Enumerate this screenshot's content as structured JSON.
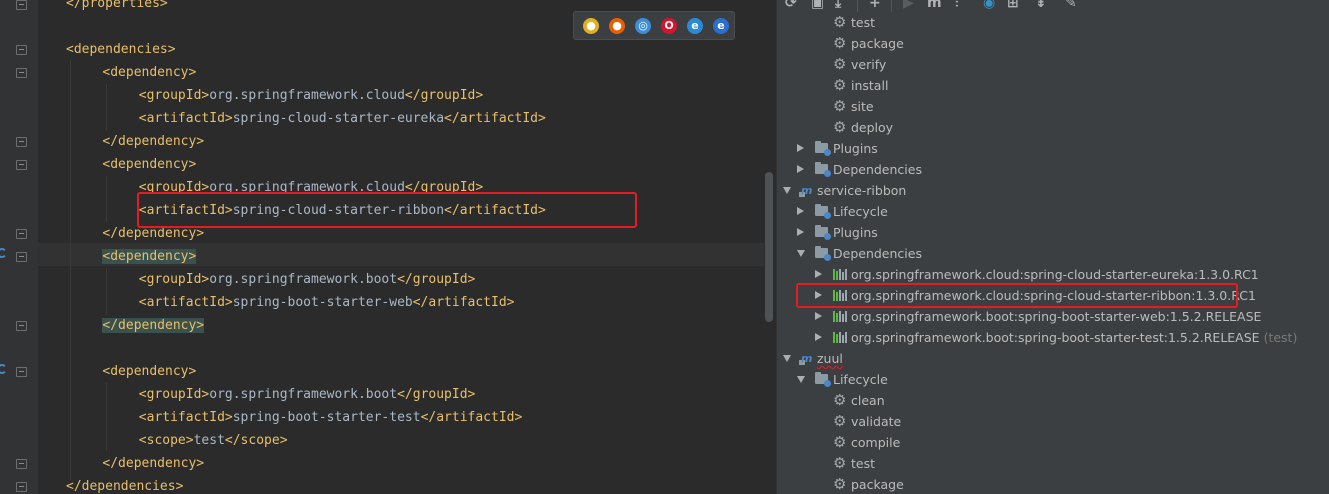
{
  "editor": {
    "lines": [
      {
        "indent": 0,
        "parts": [
          {
            "t": "tag",
            "v": "</properties>"
          }
        ]
      },
      {
        "indent": 0,
        "parts": []
      },
      {
        "indent": 0,
        "parts": [
          {
            "t": "tag",
            "v": "<dependencies>"
          }
        ]
      },
      {
        "indent": 1,
        "parts": [
          {
            "t": "tag",
            "v": "<dependency>"
          }
        ]
      },
      {
        "indent": 2,
        "parts": [
          {
            "t": "tag",
            "v": "<groupId>"
          },
          {
            "t": "text",
            "v": "org.springframework.cloud"
          },
          {
            "t": "tag",
            "v": "</groupId>"
          }
        ]
      },
      {
        "indent": 2,
        "parts": [
          {
            "t": "tag",
            "v": "<artifactId>"
          },
          {
            "t": "text",
            "v": "spring-cloud-starter-eureka"
          },
          {
            "t": "tag",
            "v": "</artifactId>"
          }
        ]
      },
      {
        "indent": 1,
        "parts": [
          {
            "t": "tag",
            "v": "</dependency>"
          }
        ]
      },
      {
        "indent": 1,
        "parts": [
          {
            "t": "tag",
            "v": "<dependency>"
          }
        ]
      },
      {
        "indent": 2,
        "parts": [
          {
            "t": "tag",
            "v": "<groupId>"
          },
          {
            "t": "text",
            "v": "org.springframework.cloud"
          },
          {
            "t": "tag",
            "v": "</groupId>"
          }
        ]
      },
      {
        "indent": 2,
        "parts": [
          {
            "t": "tag",
            "v": "<artifactId>"
          },
          {
            "t": "text",
            "v": "spring-cloud-starter-ribbon"
          },
          {
            "t": "tag",
            "v": "</artifactId>"
          }
        ]
      },
      {
        "indent": 1,
        "parts": [
          {
            "t": "tag",
            "v": "</dependency>"
          }
        ]
      },
      {
        "indent": 1,
        "parts": [
          {
            "t": "tag",
            "v": "<dependency>",
            "hl": true
          }
        ]
      },
      {
        "indent": 2,
        "parts": [
          {
            "t": "tag",
            "v": "<groupId>"
          },
          {
            "t": "text",
            "v": "org.springframework.boot"
          },
          {
            "t": "tag",
            "v": "</groupId>"
          }
        ]
      },
      {
        "indent": 2,
        "parts": [
          {
            "t": "tag",
            "v": "<artifactId>"
          },
          {
            "t": "text",
            "v": "spring-boot-starter-web"
          },
          {
            "t": "tag",
            "v": "</artifactId>"
          }
        ]
      },
      {
        "indent": 1,
        "parts": [
          {
            "t": "tag",
            "v": "</dependency>",
            "hl": true
          }
        ]
      },
      {
        "indent": 0,
        "parts": []
      },
      {
        "indent": 1,
        "parts": [
          {
            "t": "tag",
            "v": "<dependency>"
          }
        ]
      },
      {
        "indent": 2,
        "parts": [
          {
            "t": "tag",
            "v": "<groupId>"
          },
          {
            "t": "text",
            "v": "org.springframework.boot"
          },
          {
            "t": "tag",
            "v": "</groupId>"
          }
        ]
      },
      {
        "indent": 2,
        "parts": [
          {
            "t": "tag",
            "v": "<artifactId>"
          },
          {
            "t": "text",
            "v": "spring-boot-starter-test"
          },
          {
            "t": "tag",
            "v": "</artifactId>"
          }
        ]
      },
      {
        "indent": 2,
        "parts": [
          {
            "t": "tag",
            "v": "<scope>"
          },
          {
            "t": "text",
            "v": "test"
          },
          {
            "t": "tag",
            "v": "</scope>"
          }
        ]
      },
      {
        "indent": 1,
        "parts": [
          {
            "t": "tag",
            "v": "</dependency>"
          }
        ]
      },
      {
        "indent": 0,
        "parts": [
          {
            "t": "tag",
            "v": "</dependencies>"
          }
        ]
      }
    ],
    "browser_icons": [
      {
        "name": "chrome-icon",
        "glyph": "●",
        "color": "#e0b020"
      },
      {
        "name": "firefox-icon",
        "glyph": "●",
        "color": "#e66000"
      },
      {
        "name": "safari-icon",
        "glyph": "◎",
        "color": "#3b8fd9"
      },
      {
        "name": "opera-icon",
        "glyph": "O",
        "color": "#d7142e"
      },
      {
        "name": "internet-explorer-icon",
        "glyph": "e",
        "color": "#2b8ad6"
      },
      {
        "name": "edge-icon",
        "glyph": "e",
        "color": "#2a6fd0"
      }
    ]
  },
  "maven": {
    "toolbar_icons": [
      "refresh-icon",
      "reimport-icon",
      "download-icon",
      "add-icon",
      "run-icon",
      "maven-goal-icon",
      "toggle-offline-icon",
      "skip-tests-icon",
      "show-dependencies-icon",
      "collapse-all-icon",
      "settings-icon"
    ],
    "rows": [
      {
        "level": 3,
        "icon": "gear",
        "label": "test"
      },
      {
        "level": 3,
        "icon": "gear",
        "label": "package"
      },
      {
        "level": 3,
        "icon": "gear",
        "label": "verify"
      },
      {
        "level": 3,
        "icon": "gear",
        "label": "install"
      },
      {
        "level": 3,
        "icon": "gear",
        "label": "site"
      },
      {
        "level": 3,
        "icon": "gear",
        "label": "deploy"
      },
      {
        "level": 2,
        "arrow": "r",
        "icon": "folder",
        "label": "Plugins"
      },
      {
        "level": 2,
        "arrow": "r",
        "icon": "folder",
        "label": "Dependencies"
      },
      {
        "level": 1,
        "arrow": "d",
        "icon": "module",
        "label": "service-ribbon"
      },
      {
        "level": 2,
        "arrow": "r",
        "icon": "folder",
        "label": "Lifecycle"
      },
      {
        "level": 2,
        "arrow": "r",
        "icon": "folder",
        "label": "Plugins"
      },
      {
        "level": 2,
        "arrow": "d",
        "icon": "folder",
        "label": "Dependencies"
      },
      {
        "level": 3,
        "arrow": "r",
        "icon": "lib",
        "label": "org.springframework.cloud:spring-cloud-starter-eureka:1.3.0.RC1"
      },
      {
        "level": 3,
        "arrow": "r",
        "icon": "lib",
        "label": "org.springframework.cloud:spring-cloud-starter-ribbon:1.3.0.RC1"
      },
      {
        "level": 3,
        "arrow": "r",
        "icon": "lib",
        "label": "org.springframework.boot:spring-boot-starter-web:1.5.2.RELEASE"
      },
      {
        "level": 3,
        "arrow": "r",
        "icon": "lib",
        "label": "org.springframework.boot:spring-boot-starter-test:1.5.2.RELEASE",
        "suffix": "(test)"
      },
      {
        "level": 1,
        "arrow": "d",
        "icon": "module",
        "label": "zuul",
        "squiggle": true
      },
      {
        "level": 2,
        "arrow": "d",
        "icon": "folder",
        "label": "Lifecycle"
      },
      {
        "level": 3,
        "icon": "gear",
        "label": "clean"
      },
      {
        "level": 3,
        "icon": "gear",
        "label": "validate"
      },
      {
        "level": 3,
        "icon": "gear",
        "label": "compile"
      },
      {
        "level": 3,
        "icon": "gear",
        "label": "test"
      },
      {
        "level": 3,
        "icon": "gear",
        "label": "package"
      }
    ]
  },
  "colors": {
    "highlight_box": "#e51c23",
    "tag": "#e8bf6a",
    "text": "#a9b7c6",
    "tree_text": "#bbbbbb"
  }
}
